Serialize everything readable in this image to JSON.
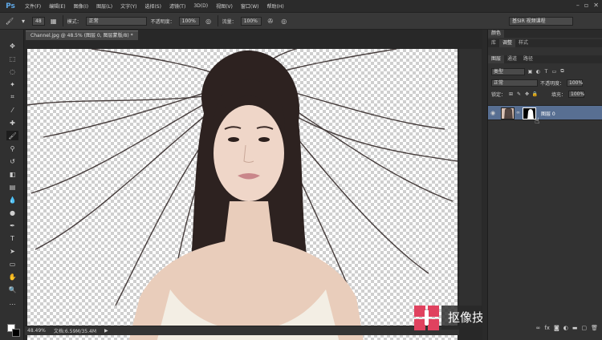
{
  "app": {
    "logo": "Ps"
  },
  "menu": [
    "文件(F)",
    "编辑(E)",
    "图像(I)",
    "图层(L)",
    "文字(Y)",
    "选择(S)",
    "滤镜(T)",
    "3D(D)",
    "视图(V)",
    "窗口(W)",
    "帮助(H)"
  ],
  "window_controls": [
    "–",
    "▫",
    "✕"
  ],
  "options": {
    "brush_size": "48",
    "mode_label": "模式：",
    "mode_value": "正常",
    "opacity_label": "不透明度：",
    "opacity_value": "100%",
    "flow_label": "流量：",
    "flow_value": "100%",
    "workspace": "基SIR 视频课程"
  },
  "document": {
    "tab_title": "Channel.jpg @ 48.5% (图层 0, 图层蒙版/8) *",
    "zoom": "48.49%",
    "doc_size": "文档:6.59M/35.4M"
  },
  "banner": {
    "text": "抠像技术全面深入",
    "logo_color": "#e0425f"
  },
  "panels": {
    "top_tabs": [
      "颜色",
      "库",
      "调整",
      "样式"
    ],
    "layer_tabs": [
      "图层",
      "通道",
      "路径"
    ],
    "kind_filter": "类型",
    "blend_mode": "正常",
    "opacity_label": "不透明度：",
    "opacity_value": "100%",
    "lock_label": "锁定：",
    "fill_label": "填充：",
    "fill_value": "100%",
    "layer_name": "图层 0"
  },
  "colors": {
    "accent": "#586f92",
    "panel_bg": "#323232",
    "chrome": "#2b2b2b"
  }
}
